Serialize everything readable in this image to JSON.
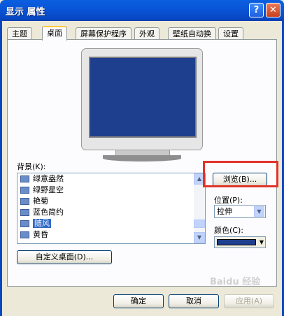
{
  "window": {
    "title": "显示 属性",
    "help_label": "?",
    "close_label": "✕"
  },
  "tabs": [
    {
      "label": "主题"
    },
    {
      "label": "桌面"
    },
    {
      "label": "屏幕保护程序"
    },
    {
      "label": "外观"
    },
    {
      "label": "壁纸自动换"
    },
    {
      "label": "设置"
    }
  ],
  "background": {
    "label": "背景(K):",
    "items": [
      {
        "label": "绿意盎然"
      },
      {
        "label": "绿野星空"
      },
      {
        "label": "艳菊"
      },
      {
        "label": "蓝色简约"
      },
      {
        "label": "随风"
      },
      {
        "label": "黄昏"
      }
    ],
    "selected": "随风"
  },
  "browse_label": "浏览(B)...",
  "position": {
    "label": "位置(P):",
    "value": "拉伸"
  },
  "color": {
    "label": "颜色(C):",
    "value": "#1E3E8E"
  },
  "customize_label": "自定义桌面(D)...",
  "footer": {
    "ok_label": "确定",
    "cancel_label": "取消",
    "apply_label": "应用(A)"
  },
  "watermark": "Baidu 经验"
}
